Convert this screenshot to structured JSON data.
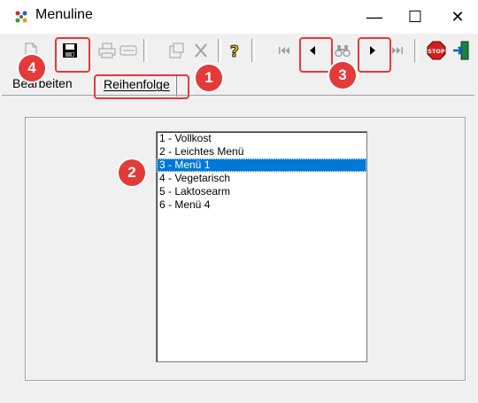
{
  "window": {
    "title": "Menuline"
  },
  "titlebar": {
    "minimize_label": "—",
    "maximize_label": "☐",
    "close_label": "✕"
  },
  "toolbar": {
    "buttons": [
      {
        "icon": "new-document-icon",
        "enabled": false
      },
      {
        "icon": "save-icon",
        "enabled": true
      },
      {
        "icon": "print-icon",
        "enabled": false
      },
      {
        "icon": "preview-icon",
        "enabled": false
      },
      {
        "icon": "properties-icon",
        "enabled": false
      },
      {
        "icon": "delete-icon",
        "enabled": false
      },
      {
        "icon": "help-icon",
        "enabled": true
      },
      {
        "icon": "first-record-icon",
        "enabled": false
      },
      {
        "icon": "previous-record-icon",
        "enabled": true
      },
      {
        "icon": "find-binoculars-icon",
        "enabled": false
      },
      {
        "icon": "next-record-icon",
        "enabled": true
      },
      {
        "icon": "last-record-icon",
        "enabled": false
      },
      {
        "icon": "stop-icon",
        "enabled": true
      },
      {
        "icon": "exit-icon",
        "enabled": true
      }
    ]
  },
  "tabs": [
    {
      "label": "Bearbeiten",
      "active": false
    },
    {
      "label": "Reihenfolge",
      "active": true
    }
  ],
  "list": {
    "items": [
      "1 - Vollkost",
      "2 - Leichtes Menü",
      "3 - Menü 1",
      "4 - Vegetarisch",
      "5 - Laktosearm",
      "6 - Menü 4"
    ],
    "selected_index": 2
  },
  "annotations": {
    "badge1": "1",
    "badge2": "2",
    "badge3": "3",
    "badge4": "4",
    "color": "#e33a3a"
  },
  "colors": {
    "selection": "#0078d7",
    "window_bg": "#f0f0f0"
  }
}
